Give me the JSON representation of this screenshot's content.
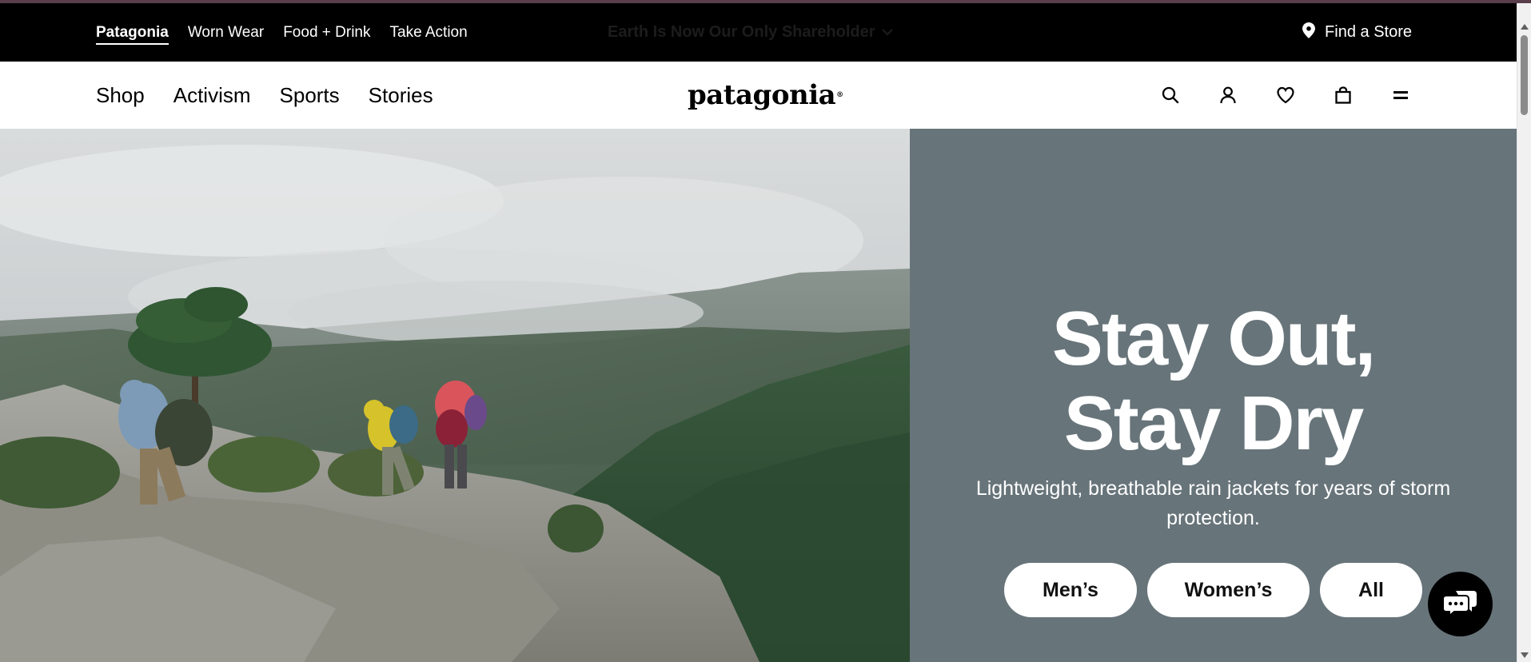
{
  "utility_bar": {
    "links": [
      "Patagonia",
      "Worn Wear",
      "Food + Drink",
      "Take Action"
    ],
    "announcement": "Earth Is Now Our Only Shareholder",
    "find_store": "Find a Store"
  },
  "main_nav": {
    "links": [
      "Shop",
      "Activism",
      "Sports",
      "Stories"
    ],
    "logo": "patagonia"
  },
  "icons": {
    "utility": [
      "location-pin-icon",
      "chevron-down-icon"
    ],
    "nav": [
      "search-icon",
      "account-icon",
      "wishlist-heart-icon",
      "shopping-bag-icon",
      "menu-icon"
    ],
    "chat": "chat-icon"
  },
  "hero": {
    "title_line1": "Stay Out,",
    "title_line2": "Stay Dry",
    "subtitle": "Lightweight, breathable rain jackets for years of storm protection.",
    "buttons": [
      "Men’s",
      "Women’s",
      "All"
    ]
  },
  "colors": {
    "utility_bar": "#000000",
    "hero_panel": "#67747a",
    "top_accent": "#5a3e4a"
  }
}
